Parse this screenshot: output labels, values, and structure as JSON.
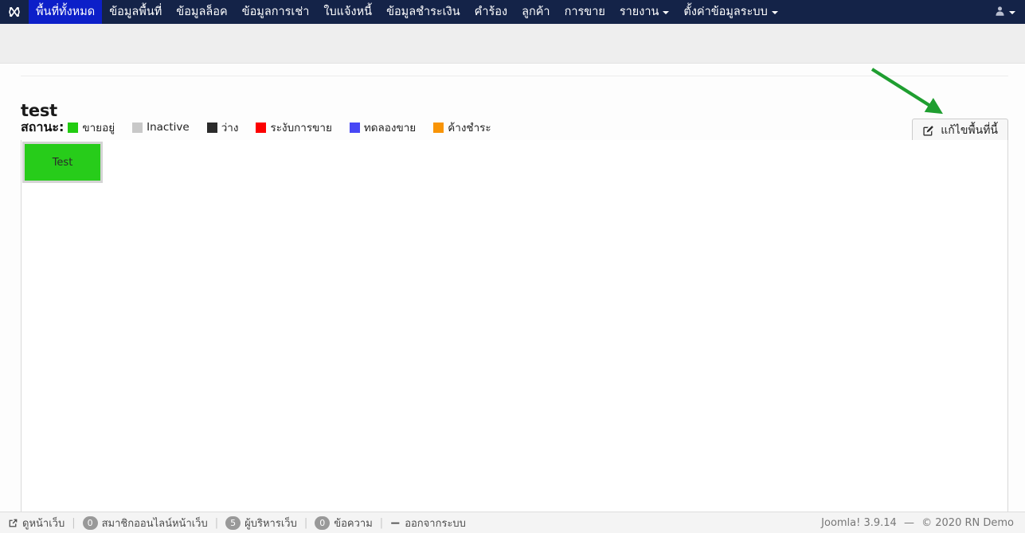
{
  "navbar": {
    "brand_icon": "joomla-logo-icon",
    "items": [
      {
        "label": "พื้นที่ทั้งหมด",
        "active": true,
        "dropdown": false
      },
      {
        "label": "ข้อมูลพื้นที่",
        "active": false,
        "dropdown": false
      },
      {
        "label": "ข้อมูลล็อค",
        "active": false,
        "dropdown": false
      },
      {
        "label": "ข้อมูลการเช่า",
        "active": false,
        "dropdown": false
      },
      {
        "label": "ใบแจ้งหนี้",
        "active": false,
        "dropdown": false
      },
      {
        "label": "ข้อมูลชำระเงิน",
        "active": false,
        "dropdown": false
      },
      {
        "label": "คำร้อง",
        "active": false,
        "dropdown": false
      },
      {
        "label": "ลูกค้า",
        "active": false,
        "dropdown": false
      },
      {
        "label": "การขาย",
        "active": false,
        "dropdown": false
      },
      {
        "label": "รายงาน",
        "active": false,
        "dropdown": true
      },
      {
        "label": "ตั้งค่าข้อมูลระบบ",
        "active": false,
        "dropdown": true
      }
    ],
    "user_menu_icon": "user-icon"
  },
  "main": {
    "title": "test",
    "legend_label": "สถานะ:",
    "legend": [
      {
        "label": "ขายอยู่",
        "color": "#22cc11"
      },
      {
        "label": "Inactive",
        "color": "#c8c8c8"
      },
      {
        "label": "ว่าง",
        "color": "#2b2b2b"
      },
      {
        "label": "ระงับการขาย",
        "color": "#fc0000"
      },
      {
        "label": "ทดลองขาย",
        "color": "#4747f5"
      },
      {
        "label": "ค้างชำระ",
        "color": "#f89406"
      }
    ],
    "edit_button": {
      "label": "แก้ไขพื้นที่นี้",
      "icon": "pencil-square-icon"
    },
    "zones": [
      {
        "label": "Test",
        "color": "#27cc1a",
        "border": "#d4d4d4"
      }
    ],
    "annotation": {
      "type": "arrow",
      "color": "#1f9e30",
      "points_to": "edit-button"
    }
  },
  "footer": {
    "items": [
      {
        "icon": "external-link-icon",
        "badge": null,
        "label": "ดูหน้าเว็บ"
      },
      {
        "icon": null,
        "badge": "0",
        "label": "สมาชิกออนไลน์หน้าเว็บ"
      },
      {
        "icon": null,
        "badge": "5",
        "label": "ผู้บริหารเว็บ"
      },
      {
        "icon": null,
        "badge": "0",
        "label": "ข้อความ"
      },
      {
        "icon": "logout-icon",
        "badge": null,
        "label": "ออกจากระบบ"
      }
    ],
    "version": "Joomla! 3.9.14",
    "separator": "—",
    "copyright": "© 2020 RN Demo"
  }
}
